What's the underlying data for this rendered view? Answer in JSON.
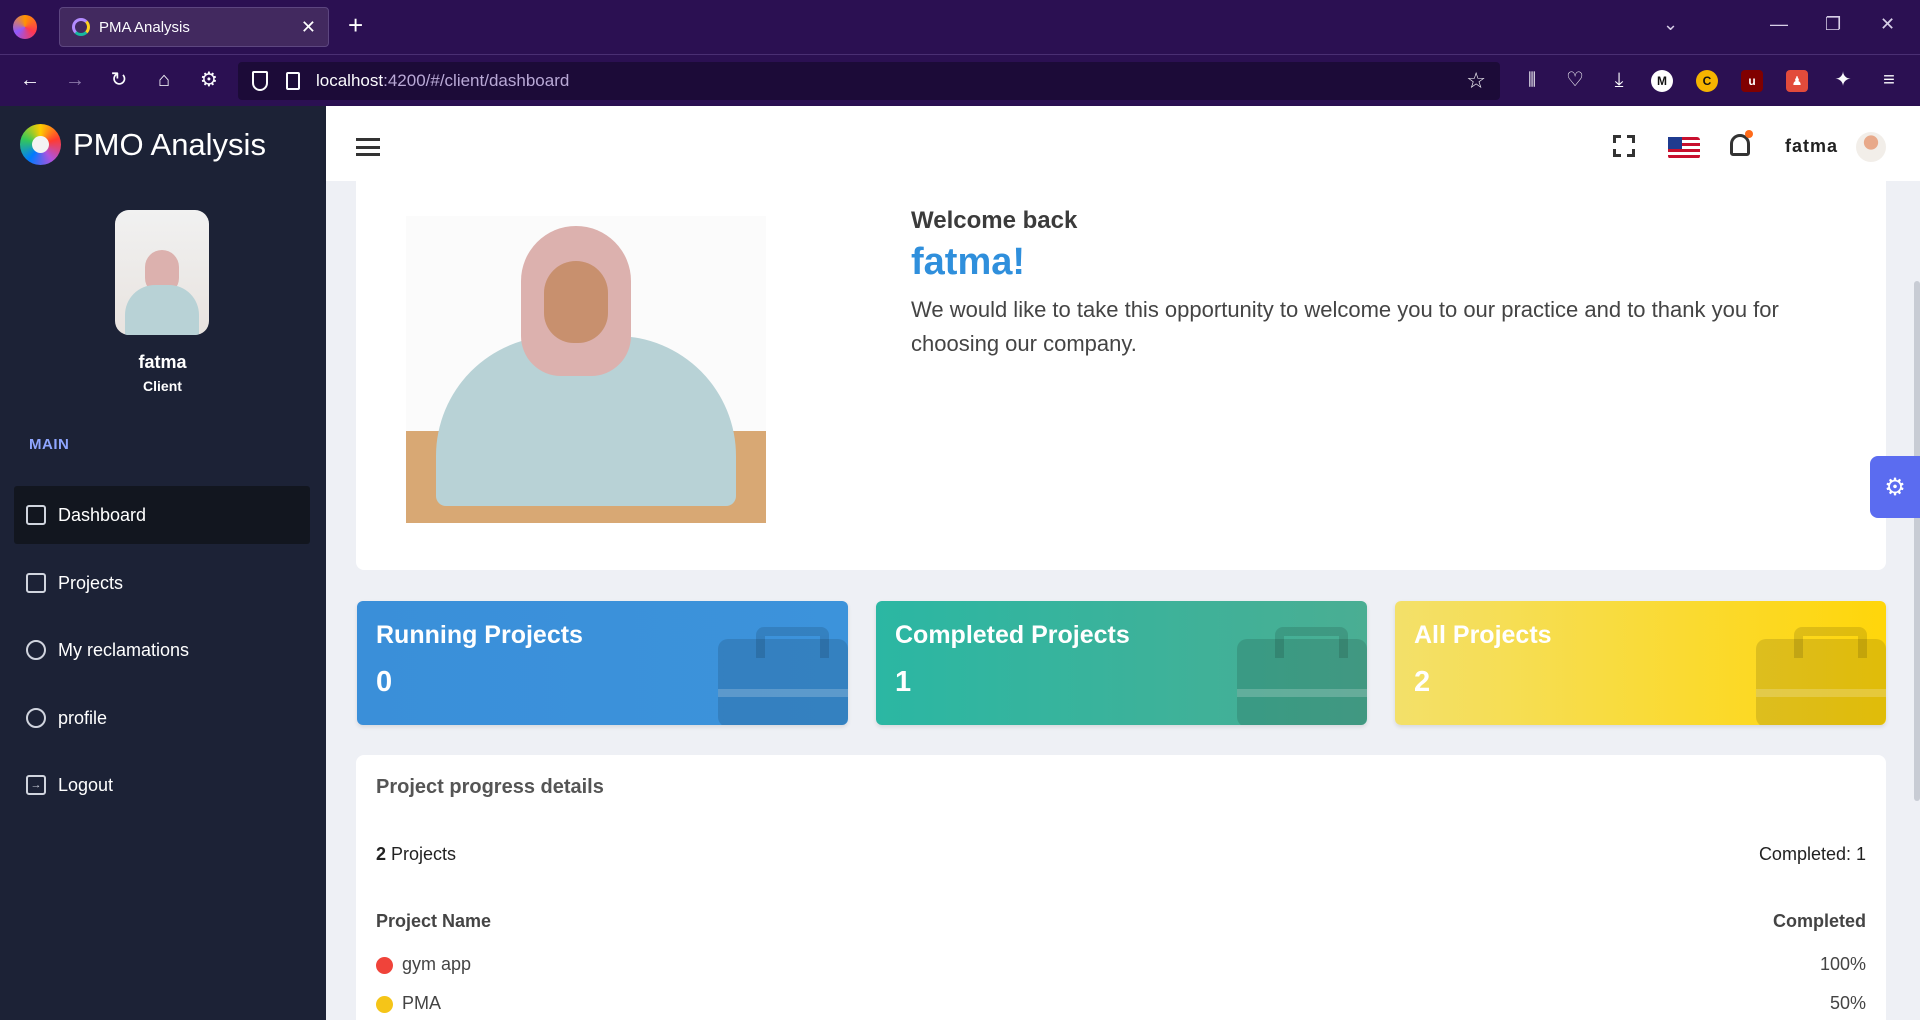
{
  "browser": {
    "tab_title": "PMA Analysis",
    "url_host": "localhost",
    "url_path": ":4200/#/client/dashboard"
  },
  "sidebar": {
    "brand": "PMO Analysis",
    "user_name": "fatma",
    "user_role": "Client",
    "section_label": "MAIN",
    "items": [
      {
        "label": "Dashboard",
        "icon": "monitor-icon",
        "active": true
      },
      {
        "label": "Projects",
        "icon": "book-icon",
        "active": false
      },
      {
        "label": "My reclamations",
        "icon": "cluster-icon",
        "active": false
      },
      {
        "label": "profile",
        "icon": "gear-icon",
        "active": false
      },
      {
        "label": "Logout",
        "icon": "logout-icon",
        "active": false
      }
    ]
  },
  "topbar": {
    "user_name": "fatma"
  },
  "welcome": {
    "greeting": "Welcome back",
    "name": "fatma!",
    "message": "We would like to take this opportunity to welcome you to our practice and to thank you for choosing our company."
  },
  "stats": [
    {
      "title": "Running Projects",
      "value": "0"
    },
    {
      "title": "Completed Projects",
      "value": "1"
    },
    {
      "title": "All Projects",
      "value": "2"
    }
  ],
  "progress": {
    "title": "Project progress details",
    "count": "2",
    "count_suffix": " Projects",
    "completed_text": "Completed: 1",
    "col_name": "Project Name",
    "col_completed": "Completed",
    "rows": [
      {
        "name": "gym app",
        "value": "100%",
        "color": "#f0433a"
      },
      {
        "name": "PMA",
        "value": "50%",
        "color": "#f5c518"
      }
    ]
  },
  "colors": {
    "sidebar_bg": "#1c2236",
    "accent_blue": "#2f8fdc",
    "settings_button": "#5b6cf0"
  }
}
